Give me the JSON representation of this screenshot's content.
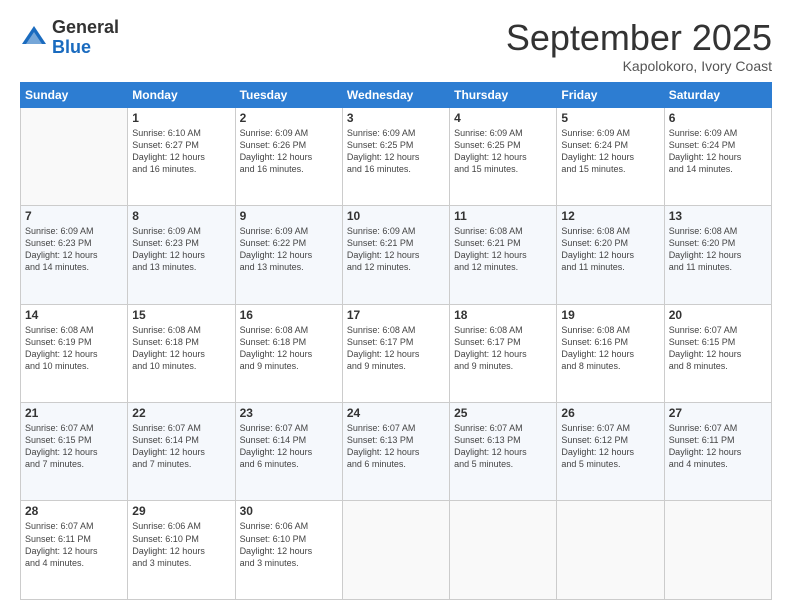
{
  "logo": {
    "general": "General",
    "blue": "Blue"
  },
  "header": {
    "month": "September 2025",
    "location": "Kapolokoro, Ivory Coast"
  },
  "days_of_week": [
    "Sunday",
    "Monday",
    "Tuesday",
    "Wednesday",
    "Thursday",
    "Friday",
    "Saturday"
  ],
  "weeks": [
    [
      {
        "day": "",
        "info": ""
      },
      {
        "day": "1",
        "info": "Sunrise: 6:10 AM\nSunset: 6:27 PM\nDaylight: 12 hours\nand 16 minutes."
      },
      {
        "day": "2",
        "info": "Sunrise: 6:09 AM\nSunset: 6:26 PM\nDaylight: 12 hours\nand 16 minutes."
      },
      {
        "day": "3",
        "info": "Sunrise: 6:09 AM\nSunset: 6:25 PM\nDaylight: 12 hours\nand 16 minutes."
      },
      {
        "day": "4",
        "info": "Sunrise: 6:09 AM\nSunset: 6:25 PM\nDaylight: 12 hours\nand 15 minutes."
      },
      {
        "day": "5",
        "info": "Sunrise: 6:09 AM\nSunset: 6:24 PM\nDaylight: 12 hours\nand 15 minutes."
      },
      {
        "day": "6",
        "info": "Sunrise: 6:09 AM\nSunset: 6:24 PM\nDaylight: 12 hours\nand 14 minutes."
      }
    ],
    [
      {
        "day": "7",
        "info": "Sunrise: 6:09 AM\nSunset: 6:23 PM\nDaylight: 12 hours\nand 14 minutes."
      },
      {
        "day": "8",
        "info": "Sunrise: 6:09 AM\nSunset: 6:23 PM\nDaylight: 12 hours\nand 13 minutes."
      },
      {
        "day": "9",
        "info": "Sunrise: 6:09 AM\nSunset: 6:22 PM\nDaylight: 12 hours\nand 13 minutes."
      },
      {
        "day": "10",
        "info": "Sunrise: 6:09 AM\nSunset: 6:21 PM\nDaylight: 12 hours\nand 12 minutes."
      },
      {
        "day": "11",
        "info": "Sunrise: 6:08 AM\nSunset: 6:21 PM\nDaylight: 12 hours\nand 12 minutes."
      },
      {
        "day": "12",
        "info": "Sunrise: 6:08 AM\nSunset: 6:20 PM\nDaylight: 12 hours\nand 11 minutes."
      },
      {
        "day": "13",
        "info": "Sunrise: 6:08 AM\nSunset: 6:20 PM\nDaylight: 12 hours\nand 11 minutes."
      }
    ],
    [
      {
        "day": "14",
        "info": "Sunrise: 6:08 AM\nSunset: 6:19 PM\nDaylight: 12 hours\nand 10 minutes."
      },
      {
        "day": "15",
        "info": "Sunrise: 6:08 AM\nSunset: 6:18 PM\nDaylight: 12 hours\nand 10 minutes."
      },
      {
        "day": "16",
        "info": "Sunrise: 6:08 AM\nSunset: 6:18 PM\nDaylight: 12 hours\nand 9 minutes."
      },
      {
        "day": "17",
        "info": "Sunrise: 6:08 AM\nSunset: 6:17 PM\nDaylight: 12 hours\nand 9 minutes."
      },
      {
        "day": "18",
        "info": "Sunrise: 6:08 AM\nSunset: 6:17 PM\nDaylight: 12 hours\nand 9 minutes."
      },
      {
        "day": "19",
        "info": "Sunrise: 6:08 AM\nSunset: 6:16 PM\nDaylight: 12 hours\nand 8 minutes."
      },
      {
        "day": "20",
        "info": "Sunrise: 6:07 AM\nSunset: 6:15 PM\nDaylight: 12 hours\nand 8 minutes."
      }
    ],
    [
      {
        "day": "21",
        "info": "Sunrise: 6:07 AM\nSunset: 6:15 PM\nDaylight: 12 hours\nand 7 minutes."
      },
      {
        "day": "22",
        "info": "Sunrise: 6:07 AM\nSunset: 6:14 PM\nDaylight: 12 hours\nand 7 minutes."
      },
      {
        "day": "23",
        "info": "Sunrise: 6:07 AM\nSunset: 6:14 PM\nDaylight: 12 hours\nand 6 minutes."
      },
      {
        "day": "24",
        "info": "Sunrise: 6:07 AM\nSunset: 6:13 PM\nDaylight: 12 hours\nand 6 minutes."
      },
      {
        "day": "25",
        "info": "Sunrise: 6:07 AM\nSunset: 6:13 PM\nDaylight: 12 hours\nand 5 minutes."
      },
      {
        "day": "26",
        "info": "Sunrise: 6:07 AM\nSunset: 6:12 PM\nDaylight: 12 hours\nand 5 minutes."
      },
      {
        "day": "27",
        "info": "Sunrise: 6:07 AM\nSunset: 6:11 PM\nDaylight: 12 hours\nand 4 minutes."
      }
    ],
    [
      {
        "day": "28",
        "info": "Sunrise: 6:07 AM\nSunset: 6:11 PM\nDaylight: 12 hours\nand 4 minutes."
      },
      {
        "day": "29",
        "info": "Sunrise: 6:06 AM\nSunset: 6:10 PM\nDaylight: 12 hours\nand 3 minutes."
      },
      {
        "day": "30",
        "info": "Sunrise: 6:06 AM\nSunset: 6:10 PM\nDaylight: 12 hours\nand 3 minutes."
      },
      {
        "day": "",
        "info": ""
      },
      {
        "day": "",
        "info": ""
      },
      {
        "day": "",
        "info": ""
      },
      {
        "day": "",
        "info": ""
      }
    ]
  ]
}
